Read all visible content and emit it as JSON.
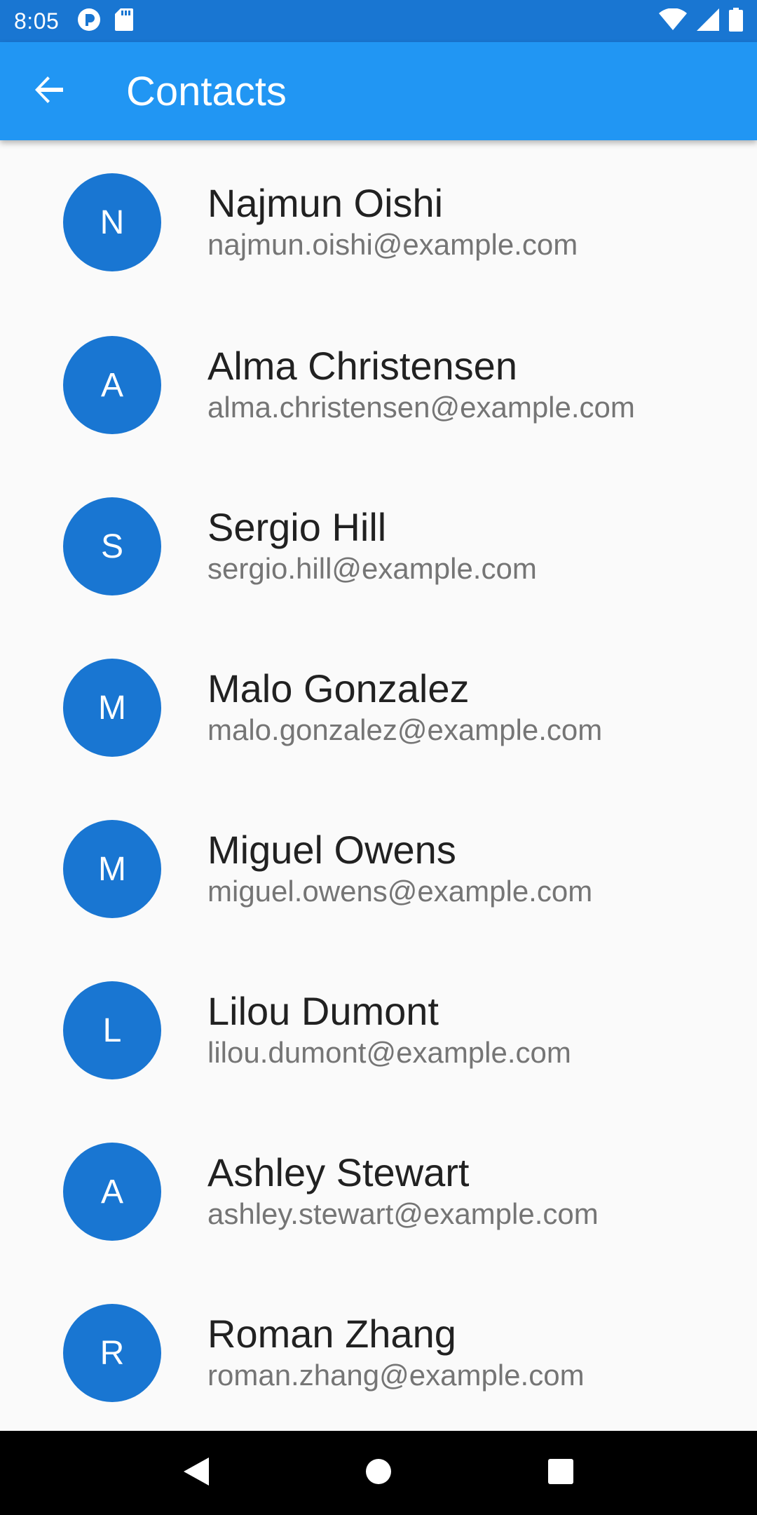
{
  "status_bar": {
    "time": "8:05",
    "left_icons": [
      "notification-app-icon",
      "sd-card-icon"
    ],
    "right_icons": [
      "wifi-icon",
      "cell-signal-icon",
      "battery-icon"
    ]
  },
  "app_bar": {
    "title": "Contacts",
    "back_icon": "arrow-back-icon",
    "color": "#2196f3"
  },
  "colors": {
    "status_bar": "#1976d2",
    "avatar": "#1976d2",
    "background": "#fafafa"
  },
  "contacts": [
    {
      "initial": "N",
      "name": "Najmun Oishi",
      "email": "najmun.oishi@example.com"
    },
    {
      "initial": "A",
      "name": "Alma Christensen",
      "email": "alma.christensen@example.com"
    },
    {
      "initial": "S",
      "name": "Sergio Hill",
      "email": "sergio.hill@example.com"
    },
    {
      "initial": "M",
      "name": "Malo Gonzalez",
      "email": "malo.gonzalez@example.com"
    },
    {
      "initial": "M",
      "name": "Miguel Owens",
      "email": "miguel.owens@example.com"
    },
    {
      "initial": "L",
      "name": "Lilou Dumont",
      "email": "lilou.dumont@example.com"
    },
    {
      "initial": "A",
      "name": "Ashley Stewart",
      "email": "ashley.stewart@example.com"
    },
    {
      "initial": "R",
      "name": "Roman Zhang",
      "email": "roman.zhang@example.com"
    }
  ],
  "nav_bar": {
    "buttons": [
      "back-triangle-icon",
      "home-circle-icon",
      "recents-square-icon"
    ]
  }
}
